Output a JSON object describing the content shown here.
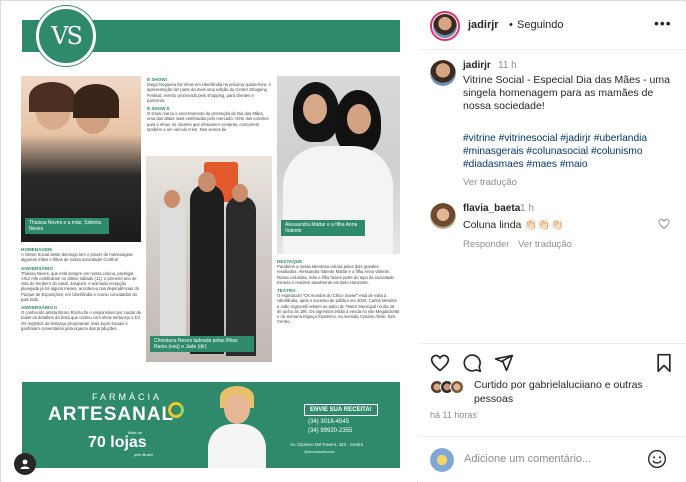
{
  "post_image": {
    "logo": "VS",
    "captions": {
      "photo1": "Thaissa Neves e a mãe, Sidnéia Neves",
      "photo2": "Christiana Neves ladeada pelas filhas Rania (esq) e Jade (dir)",
      "photo3": "Alessandra Mattar e a filha Anna Valente"
    },
    "col2": [
      {
        "h": "É SHOW!",
        "t": "Diego Nogueira faz show em Uberlândia na próxima quinta-feira. A apresentação faz parte da mais uma edição do Center Shopping Festival, evento promovido pelo shopping, para clientes e parceiros."
      },
      {
        "h": "É SHOW II",
        "t": "O show marca o encerramento da promoção de Dia das Mães, uma das datas mais celebradas pelo mercado. Além dos convites para o show, os clientes que efetuarem compras, concorrem também a um veículo 0 km. Nos vemos lá!"
      }
    ],
    "col1": [
      {
        "h": "HOMENAGEM",
        "t": "A Vitrine Social deste domingo tem o prazer de homenagear algumas mães e filhas de nossa sociedade! Confira!"
      },
      {
        "h": "ANIVERSÁRIO",
        "t": "Thaissa Neves, que está sempre em nossa coluna, prestigia Artur Alfe celebraram no último sábado (11), o primeiro ano de vida do herdeiro do casal, Joaquim. A animada recepção planejada já há alguns meses, aconteceu nas dependências do Parque de Exposições, em Uberlândia e reuniu convidados do pais todo."
      },
      {
        "h": "ANIVERSÁRIO II",
        "t": "O conhecido artista Bruno Rocha foi o responsável por cuidar de todos os detalhes da festa que contou com show sertanejo e DJ. Os registros da festança propiciaram mais laços sociais e ganharam comentários pela riqueza das produções."
      }
    ],
    "col3": [
      {
        "h": "DESTAQUE",
        "t": "Parabéns a nossa talentosa coluna pelos dois grandes resultados: Alessandra Valente Mattar e a filha Anna Valente. Nossa colunista, mãe e filha fazem parte do topo da sociedade mineira e residem atualmente em Belo Horizonte."
      },
      {
        "h": "TEATRO",
        "t": "O espetáculo \"Os mundos do Chico Xavier\" está de volta à Uberlândia, após o sucesso de público em 2023. Carlos Mendes e João Signorelli sobem ao palco do Teatro Municipal no dia 18 de junho às 19h. Os ingressos estão à venda no site Megaticketts e na Semana Espaço Esotérico, na Avenida Cesário Alvim, 619, Centro."
      }
    ],
    "ad": {
      "brand_small": "FARMÁCIA",
      "brand": "ARTESANAL",
      "mais_de": "Mais de",
      "lojas": "70 lojas",
      "pelo_brasil": "pelo Brasil",
      "recipe_button": "ENVIE SUA RECEITA!",
      "phone1": "(34) 3016-4545",
      "phone2": "(34) 99920-2355",
      "address": "Av. Cipriano Del Favero, 342 - Centro",
      "social": "@farmaciaartesanal"
    }
  },
  "header": {
    "username": "jadirjr",
    "separator": "•",
    "follow_status": "Seguindo",
    "more_icon": "more-horizontal-icon"
  },
  "caption": {
    "username": "jadirjr",
    "time": "11 h",
    "text": "Vitrine Social - Especial Dia das Mães - uma singela homenagem para as mamães de nossa sociedade!",
    "hashtags": "#vitrine #vitrinesocial #jadirjr #uberlandia #minasgerais #colunasocial #colunismo #diadasmaes #maes #maio",
    "translate": "Ver tradução"
  },
  "comment": {
    "username": "flavia_baeta",
    "time": "1 h",
    "text": "Coluna linda 👏🏻👏🏻👏🏻",
    "reply": "Responder",
    "translate": "Ver tradução"
  },
  "actions": {
    "icons": [
      "heart-icon",
      "comment-icon",
      "share-icon",
      "bookmark-icon"
    ]
  },
  "likes": {
    "text": "Curtido por gabrielaluciiano e outras pessoas"
  },
  "post_time": "há 11 horas",
  "add_comment": {
    "placeholder": "Adicione um comentário...",
    "emoji_icon": "smiley-icon"
  },
  "colors": {
    "brand_green": "#2e8a6a",
    "link_blue": "#00376b",
    "muted": "#8e8e8e",
    "border": "#dbdbdb"
  }
}
